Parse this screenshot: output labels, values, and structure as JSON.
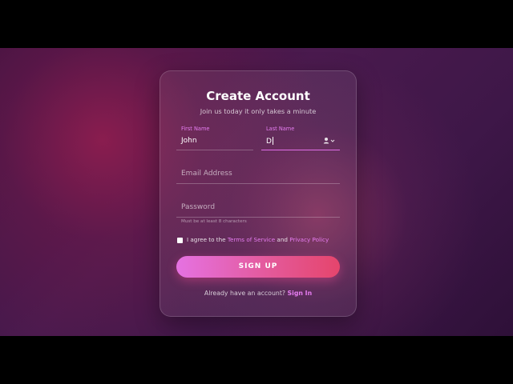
{
  "form": {
    "title": "Create Account",
    "subtitle": "Join us today it only takes a minute",
    "first_name": {
      "label": "First Name",
      "value": "John"
    },
    "last_name": {
      "label": "Last Name",
      "value": "D"
    },
    "email": {
      "placeholder": "Email Address"
    },
    "password": {
      "placeholder": "Password",
      "hint": "Must be at least 8 characters"
    },
    "agree": {
      "prefix": "I agree to the",
      "terms": "Terms of Service",
      "middle": "and",
      "privacy": "Privacy Policy"
    },
    "signup_label": "SIGN UP",
    "footer": {
      "question": "Already have an account?",
      "signin": "Sign In"
    },
    "autofill_icon": "autofill-contact-icon"
  },
  "colors": {
    "accent": "#e57cf0",
    "button_start": "#e572e2",
    "button_end": "#e5456c",
    "background": "#3a1240"
  }
}
